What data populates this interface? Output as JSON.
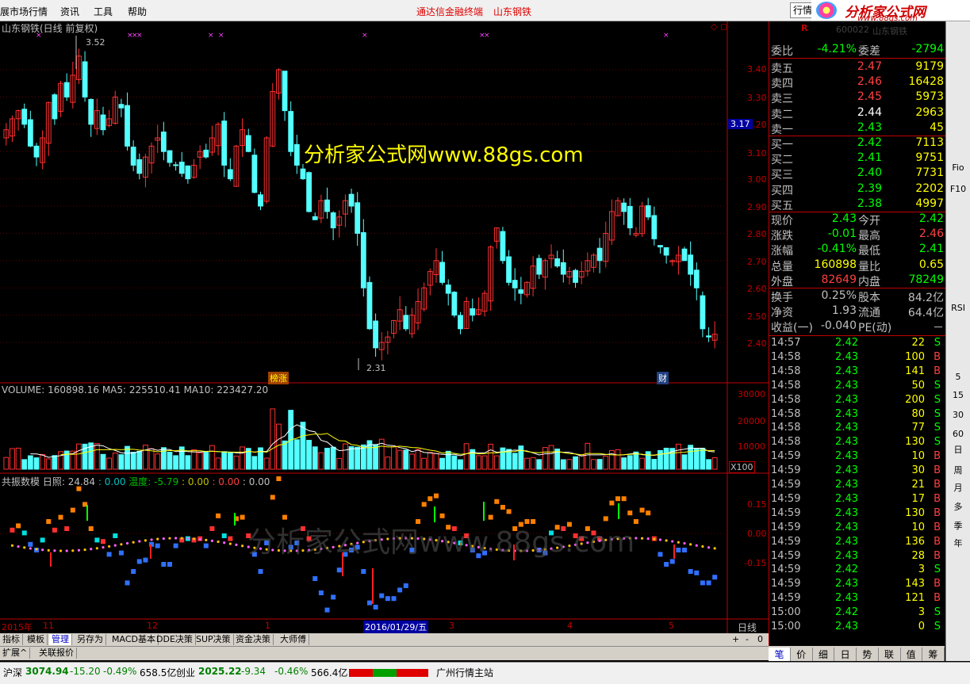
{
  "menu": {
    "items": [
      "展市场行情",
      "资讯",
      "工具",
      "帮助"
    ],
    "center_title": "通达信金融终端",
    "center_stock": "山东钢铁",
    "button": "行情",
    "logo_text": "分析家公式网",
    "logo_url": "www.88gs.com"
  },
  "chart": {
    "title": "山东钢铁(日线 前复权)",
    "watermark_main": "分析家公式网www.88gs.com",
    "watermark_sub": "分析家公式网www.88gs.com",
    "price_axis": [
      "3.40",
      "3.30",
      "3.20",
      "3.10",
      "3.00",
      "2.90",
      "2.80",
      "2.70",
      "2.60",
      "2.50",
      "2.40"
    ],
    "current_price_tag": "3.17",
    "high_marker": "3.52",
    "low_marker": "2.31",
    "event_label_1": "榜涨",
    "event_label_2": "财",
    "volume_header": "VOLUME: 160898.16  MA5: 225510.41  MA10: 223427.20",
    "volume_axis": [
      "30000",
      "20000",
      "10000"
    ],
    "volume_unit": "X100",
    "ind_header_name": "共振数模",
    "ind_header_vals": [
      {
        "text": "日照: 24.84",
        "color": "#c0c0c0"
      },
      {
        "text": ": 0.00",
        "color": "#00c0c0"
      },
      {
        "text": "温度: -5.79",
        "color": "#00c000"
      },
      {
        "text": ": 0.00",
        "color": "#c0c000"
      },
      {
        "text": ": 0.00",
        "color": "#ff4040"
      },
      {
        "text": ": 0.00",
        "color": "#c0c0c0"
      }
    ],
    "ind_axis": [
      "0.15",
      "0.00",
      "-0.15"
    ],
    "date_axis": {
      "year": "2015年",
      "m11": "11",
      "m12": "12",
      "m1": "1",
      "date_box": "2016/01/29/五",
      "m3": "3",
      "m4": "4",
      "m5": "5",
      "period": "日线"
    },
    "scroll_ctrl": [
      "+",
      "-",
      "0"
    ]
  },
  "tabs": [
    "指标",
    "模板",
    "管理",
    "另存为",
    "MACD基本",
    "DDE决策",
    "SUP决策",
    "资金决策",
    "大师傅"
  ],
  "active_tab": "管理",
  "tabs2": [
    "扩展^",
    "关联报价"
  ],
  "status": {
    "idx1_name": "沪深",
    "idx1_val": "3074.94",
    "idx1_chg": "-15.20",
    "idx1_pct": "-0.49%",
    "idx1_amt": "658.5亿",
    "idx2_name": "创业",
    "idx2_val": "2025.22",
    "idx2_chg": "-9.34",
    "idx2_pct": "-0.46%",
    "idx2_amt": "566.4亿",
    "station": "广州行情主站"
  },
  "quote": {
    "header_r": "R",
    "header_code": "600022",
    "header_name": "山东钢铁",
    "weibi_k": "委比",
    "weibi_v": "-4.21%",
    "weicha_k": "委差",
    "weicha_v": "-2794",
    "sells": [
      {
        "k": "卖五",
        "p": "2.47",
        "v": "9179",
        "pc": "#ff4040"
      },
      {
        "k": "卖四",
        "p": "2.46",
        "v": "16428",
        "pc": "#ff4040"
      },
      {
        "k": "卖三",
        "p": "2.45",
        "v": "5973",
        "pc": "#ff4040"
      },
      {
        "k": "卖二",
        "p": "2.44",
        "v": "2963",
        "pc": "#ffffff"
      },
      {
        "k": "卖一",
        "p": "2.43",
        "v": "45",
        "pc": "#00ff00"
      }
    ],
    "buys": [
      {
        "k": "买一",
        "p": "2.42",
        "v": "7113",
        "pc": "#00ff00"
      },
      {
        "k": "买二",
        "p": "2.41",
        "v": "9751",
        "pc": "#00ff00"
      },
      {
        "k": "买三",
        "p": "2.40",
        "v": "7731",
        "pc": "#00ff00"
      },
      {
        "k": "买四",
        "p": "2.39",
        "v": "2202",
        "pc": "#00ff00"
      },
      {
        "k": "买五",
        "p": "2.38",
        "v": "4997",
        "pc": "#00ff00"
      }
    ],
    "stats": [
      {
        "k1": "现价",
        "v1": "2.43",
        "c1": "#00ff00",
        "k2": "今开",
        "v2": "2.42",
        "c2": "#00ff00"
      },
      {
        "k1": "涨跌",
        "v1": "-0.01",
        "c1": "#00ff00",
        "k2": "最高",
        "v2": "2.46",
        "c2": "#ff4040"
      },
      {
        "k1": "涨幅",
        "v1": "-0.41%",
        "c1": "#00ff00",
        "k2": "最低",
        "v2": "2.41",
        "c2": "#00ff00"
      },
      {
        "k1": "总量",
        "v1": "160898",
        "c1": "#ffff00",
        "k2": "量比",
        "v2": "0.65",
        "c2": "#ffff00"
      },
      {
        "k1": "外盘",
        "v1": "82649",
        "c1": "#ff4040",
        "k2": "内盘",
        "v2": "78249",
        "c2": "#00ff00"
      }
    ],
    "stats2": [
      {
        "k1": "换手",
        "v1": "0.25%",
        "c1": "#c0c0c0",
        "k2": "股本",
        "v2": "84.2亿",
        "c2": "#c0c0c0"
      },
      {
        "k1": "净资",
        "v1": "1.93",
        "c1": "#c0c0c0",
        "k2": "流通",
        "v2": "64.4亿",
        "c2": "#c0c0c0"
      },
      {
        "k1": "收益(一)",
        "v1": "-0.040",
        "c1": "#c0c0c0",
        "k2": "PE(动)",
        "v2": "－",
        "c2": "#c0c0c0"
      }
    ],
    "ticks": [
      {
        "t": "14:57",
        "p": "2.42",
        "v": "22",
        "s": "S"
      },
      {
        "t": "14:58",
        "p": "2.43",
        "v": "100",
        "s": "B"
      },
      {
        "t": "14:58",
        "p": "2.43",
        "v": "141",
        "s": "B"
      },
      {
        "t": "14:58",
        "p": "2.43",
        "v": "50",
        "s": "S"
      },
      {
        "t": "14:58",
        "p": "2.43",
        "v": "200",
        "s": "S"
      },
      {
        "t": "14:58",
        "p": "2.43",
        "v": "80",
        "s": "S"
      },
      {
        "t": "14:58",
        "p": "2.43",
        "v": "77",
        "s": "S"
      },
      {
        "t": "14:58",
        "p": "2.43",
        "v": "130",
        "s": "S"
      },
      {
        "t": "14:59",
        "p": "2.43",
        "v": "10",
        "s": "B"
      },
      {
        "t": "14:59",
        "p": "2.43",
        "v": "30",
        "s": "B"
      },
      {
        "t": "14:59",
        "p": "2.43",
        "v": "21",
        "s": "B"
      },
      {
        "t": "14:59",
        "p": "2.43",
        "v": "17",
        "s": "B"
      },
      {
        "t": "14:59",
        "p": "2.43",
        "v": "130",
        "s": "B"
      },
      {
        "t": "14:59",
        "p": "2.43",
        "v": "10",
        "s": "B"
      },
      {
        "t": "14:59",
        "p": "2.43",
        "v": "136",
        "s": "B"
      },
      {
        "t": "14:59",
        "p": "2.43",
        "v": "28",
        "s": "B"
      },
      {
        "t": "14:59",
        "p": "2.42",
        "v": "3",
        "s": "S"
      },
      {
        "t": "14:59",
        "p": "2.43",
        "v": "143",
        "s": "B"
      },
      {
        "t": "14:59",
        "p": "2.43",
        "v": "121",
        "s": "B"
      },
      {
        "t": "15:00",
        "p": "2.42",
        "v": "3",
        "s": "S"
      },
      {
        "t": "15:00",
        "p": "2.43",
        "v": "0",
        "s": "S"
      }
    ],
    "bottom_tabs": [
      "笔",
      "价",
      "细",
      "日",
      "势",
      "联",
      "值",
      "筹"
    ]
  },
  "sidebar": [
    "Fio",
    "F10",
    "RSI",
    "5",
    "15",
    "30",
    "60",
    "日",
    "周",
    "月",
    "多",
    "季",
    "年"
  ],
  "chart_data": {
    "type": "candlestick",
    "title": "山东钢铁(日线 前复权)",
    "ylim": [
      2.31,
      3.52
    ],
    "note": "approximate daily closes read from chart, Nov 2015 - May 2016",
    "closes": [
      3.18,
      3.22,
      3.25,
      3.2,
      3.12,
      3.08,
      3.15,
      3.28,
      3.22,
      3.35,
      3.3,
      3.38,
      3.45,
      3.3,
      3.2,
      3.25,
      3.18,
      3.22,
      3.3,
      3.26,
      3.12,
      3.05,
      3.02,
      3.08,
      3.12,
      3.15,
      3.1,
      3.06,
      3.05,
      3.02,
      3.0,
      3.05,
      3.1,
      3.08,
      3.15,
      3.2,
      3.05,
      3.0,
      3.12,
      3.18,
      3.1,
      2.95,
      2.9,
      3.15,
      3.32,
      3.4,
      3.25,
      3.1,
      3.05,
      3.0,
      2.88,
      2.85,
      2.92,
      2.88,
      2.82,
      2.86,
      2.92,
      2.9,
      2.8,
      2.6,
      2.45,
      2.38,
      2.4,
      2.42,
      2.48,
      2.52,
      2.45,
      2.5,
      2.55,
      2.6,
      2.66,
      2.7,
      2.62,
      2.58,
      2.5,
      2.45,
      2.55,
      2.5,
      2.52,
      2.58,
      2.75,
      2.82,
      2.7,
      2.62,
      2.6,
      2.58,
      2.62,
      2.68,
      2.65,
      2.7,
      2.72,
      2.68,
      2.65,
      2.66,
      2.62,
      2.66,
      2.7,
      2.72,
      2.7,
      2.8,
      2.88,
      2.92,
      2.88,
      2.82,
      2.8,
      2.9,
      2.86,
      2.78,
      2.75,
      2.72,
      2.7,
      2.72,
      2.7,
      2.65,
      2.6,
      2.45,
      2.42,
      2.43
    ],
    "volume_ma": {
      "MA5": 225510.41,
      "MA10": 223427.2,
      "VOLUME": 160898.16
    }
  }
}
